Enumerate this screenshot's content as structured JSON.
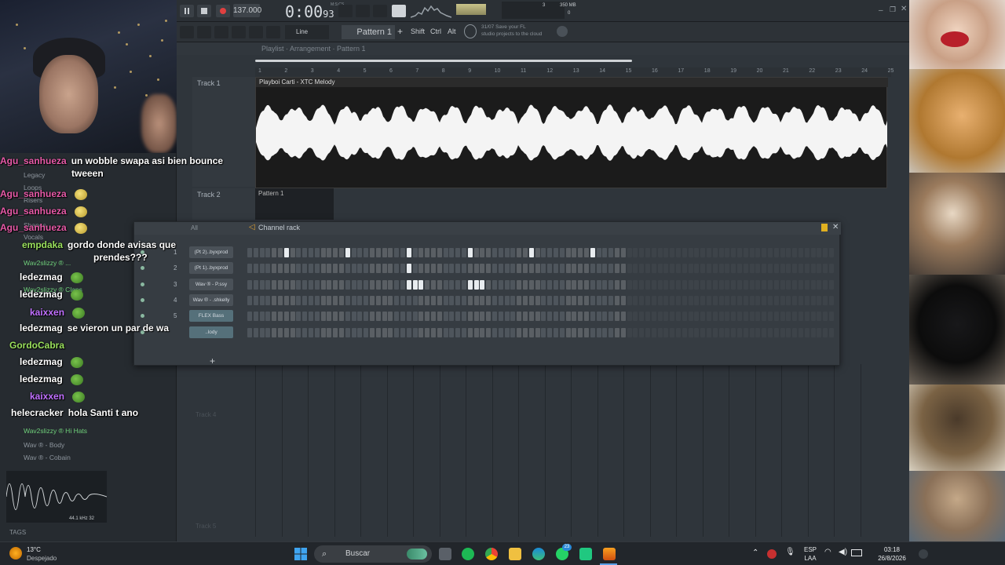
{
  "fl": {
    "tempo": "137.000",
    "time": "0:00",
    "time_small": "93",
    "time_label": "M:S:CS",
    "pattern": "Pattern 1",
    "snap": "Line",
    "hint_line1": "Save your FL",
    "hint_line2": "studio projects to the cloud",
    "hint_time": "31/07",
    "memory": "350 MB",
    "cpu_num": "3",
    "voices": "0",
    "mod_shift": "Shift",
    "mod_ctrl": "Ctrl",
    "mod_alt": "Alt",
    "breadcrumb": "Playlist · Arrangement · Pattern 1",
    "ruler_marks": [
      "1",
      "2",
      "3",
      "4",
      "5",
      "6",
      "7",
      "8",
      "9",
      "10",
      "11",
      "12",
      "13",
      "14",
      "15",
      "16",
      "17",
      "18",
      "19",
      "20",
      "21",
      "22",
      "23",
      "24",
      "25"
    ],
    "tracks": [
      {
        "label": "Track 1"
      },
      {
        "label": "Track 2"
      }
    ],
    "clip1_title": "Playboi Carti - XTC Melody",
    "clip2_title": "Pattern 1",
    "rack_title": "Channel rack",
    "rack_filter": "All",
    "channels": [
      {
        "num": "1",
        "name": "(Pt 2)..byxprod",
        "pattern": [
          0,
          0,
          0,
          0,
          0,
          0,
          1,
          0,
          0,
          0,
          0,
          0,
          0,
          0,
          0,
          0,
          1,
          0,
          0,
          0,
          0,
          0,
          0,
          0,
          0,
          0,
          1,
          0,
          0,
          0,
          0,
          0,
          0,
          0,
          0,
          0,
          1,
          0,
          0,
          0,
          0,
          0,
          0,
          0,
          0,
          0,
          1,
          0,
          0,
          0,
          0,
          0,
          0,
          0,
          0,
          0,
          1,
          0,
          0,
          0,
          0,
          0
        ]
      },
      {
        "num": "2",
        "name": "(Pt 1)..byxprod",
        "pattern": [
          0,
          0,
          0,
          0,
          0,
          0,
          0,
          0,
          0,
          0,
          0,
          0,
          0,
          0,
          0,
          0,
          0,
          0,
          0,
          0,
          0,
          0,
          0,
          0,
          0,
          0,
          1,
          0,
          0,
          0,
          0,
          0,
          0,
          0,
          0,
          0,
          0,
          0,
          0,
          0,
          0,
          0,
          0,
          0,
          0,
          0,
          0,
          0,
          0,
          0,
          0,
          0,
          0,
          0,
          0,
          0,
          0,
          0,
          0,
          0,
          0,
          0
        ]
      },
      {
        "num": "3",
        "name": "Wav ® - P.ssy",
        "pattern": [
          0,
          0,
          0,
          0,
          0,
          0,
          0,
          0,
          0,
          0,
          0,
          0,
          0,
          0,
          0,
          0,
          0,
          0,
          0,
          0,
          0,
          0,
          0,
          0,
          0,
          0,
          1,
          1,
          1,
          0,
          0,
          0,
          0,
          0,
          0,
          0,
          1,
          1,
          1,
          0,
          0,
          0,
          0,
          0,
          0,
          0,
          0,
          0,
          0,
          0,
          0,
          0,
          0,
          0,
          0,
          0,
          0,
          0,
          0,
          0,
          0,
          0
        ]
      },
      {
        "num": "4",
        "name": "Wav ® - .shkelly",
        "pattern": [
          0,
          0,
          0,
          0,
          0,
          0,
          0,
          0,
          0,
          0,
          0,
          0,
          0,
          0,
          0,
          0,
          0,
          0,
          0,
          0,
          0,
          0,
          0,
          0,
          0,
          0,
          0,
          0,
          0,
          0,
          0,
          0,
          0,
          0,
          0,
          0,
          0,
          0,
          0,
          0,
          0,
          0,
          0,
          0,
          0,
          0,
          0,
          0,
          0,
          0,
          0,
          0,
          0,
          0,
          0,
          0,
          0,
          0,
          0,
          0,
          0,
          0
        ]
      },
      {
        "num": "5",
        "name": "FLEX Bass",
        "pattern": [
          0,
          0,
          0,
          0,
          0,
          0,
          0,
          0,
          0,
          0,
          0,
          0,
          0,
          0,
          0,
          0,
          0,
          0,
          0,
          0,
          0,
          0,
          0,
          0,
          0,
          0,
          0,
          0,
          0,
          0,
          0,
          0,
          0,
          0,
          0,
          0,
          0,
          0,
          0,
          0,
          0,
          0,
          0,
          0,
          0,
          0,
          0,
          0,
          0,
          0,
          0,
          0,
          0,
          0,
          0,
          0,
          0,
          0,
          0,
          0,
          0,
          0
        ]
      },
      {
        "num": "",
        "name": "..lody",
        "pattern": [
          0,
          0,
          0,
          0,
          0,
          0,
          0,
          0,
          0,
          0,
          0,
          0,
          0,
          0,
          0,
          0,
          0,
          0,
          0,
          0,
          0,
          0,
          0,
          0,
          0,
          0,
          0,
          0,
          0,
          0,
          0,
          0,
          0,
          0,
          0,
          0,
          0,
          0,
          0,
          0,
          0,
          0,
          0,
          0,
          0,
          0,
          0,
          0,
          0,
          0,
          0,
          0,
          0,
          0,
          0,
          0,
          0,
          0,
          0,
          0,
          0,
          0
        ]
      }
    ],
    "browser_items": [
      {
        "text": "Legacy",
        "green": false
      },
      {
        "text": "Loops",
        "green": false
      },
      {
        "text": "Risers",
        "green": false
      },
      {
        "text": "Shapes",
        "green": false
      },
      {
        "text": "Vocals",
        "green": false
      },
      {
        "text": "Wav2slizzy ® ...",
        "green": true
      },
      {
        "text": "Wav2slizzy ® Claps",
        "green": true
      },
      {
        "text": "Wav2slizzy ® Hi Hats",
        "green": true
      },
      {
        "text": "Wav ® - Body",
        "green": false
      },
      {
        "text": "Wav ® - Cobain",
        "green": false
      }
    ],
    "scope_info": "44.1 kHz 32",
    "tags_label": "TAGS",
    "track_ghost": [
      "Track 4",
      "Track 5"
    ]
  },
  "chat": [
    {
      "user": "Agu_sanhueza",
      "color": "#e85aa8",
      "msg": "un wobble swapa asi bien bounce",
      "msg2": "tweeen",
      "emote": ""
    },
    {
      "user": "Agu_sanhueza",
      "color": "#e85aa8",
      "msg": "",
      "msg2": "",
      "emote": "smile"
    },
    {
      "user": "Agu_sanhueza",
      "color": "#e85aa8",
      "msg": "",
      "msg2": "",
      "emote": "smile"
    },
    {
      "user": "Agu_sanhueza",
      "color": "#e85aa8",
      "msg": "",
      "msg2": "",
      "emote": "smile"
    },
    {
      "user": "empdaka",
      "color": "#9be15d",
      "msg": "gordo donde avisas que",
      "msg2": "prendes???",
      "emote": ""
    },
    {
      "user": "ledezmag",
      "color": "#ffffff",
      "msg": "",
      "msg2": "",
      "emote": "pepe"
    },
    {
      "user": "ledezmag",
      "color": "#ffffff",
      "msg": "",
      "msg2": "",
      "emote": "pepe"
    },
    {
      "user": "kaixxen",
      "color": "#c070ff",
      "msg": "",
      "msg2": "",
      "emote": "pepe"
    },
    {
      "user": "ledezmag",
      "color": "#ffffff",
      "msg": "se vieron un par de wa",
      "msg2": "",
      "emote": ""
    },
    {
      "user": "GordoCabra",
      "color": "#9be15d",
      "msg": "",
      "msg2": "",
      "emote": ""
    },
    {
      "user": "ledezmag",
      "color": "#ffffff",
      "msg": "",
      "msg2": "",
      "emote": "pepe"
    },
    {
      "user": "ledezmag",
      "color": "#ffffff",
      "msg": "",
      "msg2": "",
      "emote": "pepe"
    },
    {
      "user": "kaixxen",
      "color": "#c070ff",
      "msg": "",
      "msg2": "",
      "emote": "pepe"
    },
    {
      "user": "helecracker",
      "color": "#ffffff",
      "msg": "hola Santi t ano",
      "msg2": "",
      "emote": ""
    }
  ],
  "taskbar": {
    "weather_temp": "13°C",
    "weather_desc": "Despejado",
    "search_placeholder": "Buscar",
    "lang1": "ESP",
    "lang2": "LAA",
    "clock_time": "03:18",
    "clock_date": "26/8/2026",
    "badge": "23"
  },
  "colors": {
    "accent": "#e8ecef",
    "rack_bg": "#363c42",
    "chat_pink": "#e85aa8",
    "chat_green": "#9be15d",
    "chat_purple": "#c070ff"
  }
}
